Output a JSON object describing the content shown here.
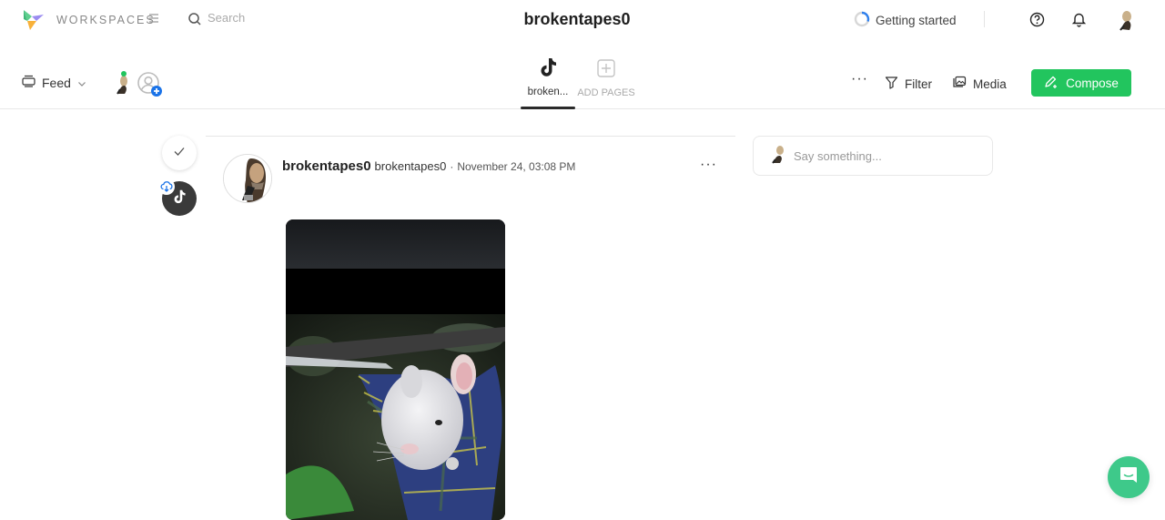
{
  "topbar": {
    "workspaces_label": "WORKSPACES",
    "search_placeholder": "Search",
    "page_title": "brokentapes0",
    "getting_started_label": "Getting started",
    "icons": [
      "logo-icon",
      "menu-icon",
      "search-icon",
      "progress-ring-icon",
      "help-icon",
      "bell-icon",
      "user-avatar"
    ]
  },
  "toolbar": {
    "feed_label": "Feed",
    "tabs": [
      {
        "label": "broken...",
        "icon": "tiktok-icon",
        "active": true
      },
      {
        "label": "ADD PAGES",
        "icon": "plus-square-icon",
        "active": false
      }
    ],
    "more_label": "···",
    "filter_label": "Filter",
    "media_label": "Media",
    "compose_label": "Compose"
  },
  "post": {
    "display_name": "brokentapes0",
    "handle": "brokentapes0",
    "separator": "·",
    "date": "November 24, 03:08 PM",
    "more_label": "···",
    "media_description": "video thumbnail of a white mouse in plaid shirt hanging from a branch"
  },
  "comment": {
    "placeholder": "Say something..."
  },
  "colors": {
    "accent_green": "#22c55e",
    "chat_green": "#3ec98a",
    "progress_blue": "#2f80ed",
    "badge_blue": "#1a73e8"
  }
}
